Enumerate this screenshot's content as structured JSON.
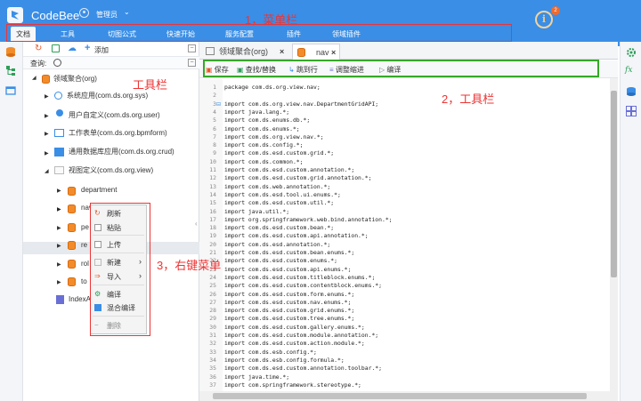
{
  "app": {
    "brand": "CodeBee",
    "user_name": "管理员",
    "notification_count": "2"
  },
  "menu": {
    "items": [
      {
        "label": "文档",
        "active": true
      },
      {
        "label": "工具"
      },
      {
        "label": "切图公式"
      },
      {
        "label": "快速开始"
      },
      {
        "label": "服务配置"
      },
      {
        "label": "插件"
      },
      {
        "label": "领域插件"
      }
    ]
  },
  "annotations": {
    "menu_bar": "1，菜单栏",
    "toolbar": "2，工具栏",
    "left_toolbar": "工具栏",
    "context_menu": "3，右键菜单"
  },
  "left": {
    "add_label": "添加",
    "query_label": "查询:",
    "tree": [
      {
        "label": "领域聚合(org)"
      },
      {
        "label": "系统应用(com.ds.org.sys)"
      },
      {
        "label": "用户自定义(com.ds.org.user)"
      },
      {
        "label": "工作表单(com.ds.org.bpmform)"
      },
      {
        "label": "通用数据库应用(com.ds.org.crud)"
      },
      {
        "label": "视图定义(com.ds.org.view)"
      },
      {
        "label": "department"
      },
      {
        "label": "nav"
      },
      {
        "label": "pe"
      },
      {
        "label": "re"
      },
      {
        "label": "rol"
      },
      {
        "label": "to"
      },
      {
        "label": "IndexA"
      }
    ]
  },
  "context_menu": {
    "items": [
      {
        "label": "刷新"
      },
      {
        "label": "粘贴"
      },
      {
        "label": "上传"
      },
      {
        "label": "新建"
      },
      {
        "label": "导入"
      },
      {
        "label": "编译"
      },
      {
        "label": "混合编译"
      },
      {
        "label": "删除"
      }
    ]
  },
  "editor": {
    "tabs": [
      {
        "label": "领域聚合(org)"
      },
      {
        "label": "nav",
        "active": true
      }
    ],
    "toolbar": [
      {
        "label": "保存"
      },
      {
        "label": "查找/替换"
      },
      {
        "label": "跳到行"
      },
      {
        "label": "调整缩进"
      },
      {
        "label": "编译"
      }
    ],
    "code": [
      "package com.ds.org.view.nav;",
      "",
      "import com.ds.org.view.nav.DepartmentGridAPI;",
      "import java.lang.*;",
      "import com.ds.enums.db.*;",
      "import com.ds.enums.*;",
      "import com.ds.org.view.nav.*;",
      "import com.ds.config.*;",
      "import com.ds.esd.custom.grid.*;",
      "import com.ds.common.*;",
      "import com.ds.esd.custom.annotation.*;",
      "import com.ds.esd.custom.grid.annotation.*;",
      "import com.ds.web.annotation.*;",
      "import com.ds.esd.tool.ui.enums.*;",
      "import com.ds.esd.custom.util.*;",
      "import java.util.*;",
      "import org.springframework.web.bind.annotation.*;",
      "import com.ds.esd.custom.bean.*;",
      "import com.ds.esd.custom.api.annotation.*;",
      "import com.ds.esd.annotation.*;",
      "import com.ds.esd.custom.bean.enums.*;",
      "import com.ds.esd.custom.enums.*;",
      "import com.ds.esd.custom.api.enums.*;",
      "import com.ds.esd.custom.titleblock.enums.*;",
      "import com.ds.esd.custom.contentblock.enums.*;",
      "import com.ds.esd.custom.form.enums.*;",
      "import com.ds.esd.custom.nav.enums.*;",
      "import com.ds.esd.custom.grid.enums.*;",
      "import com.ds.esd.custom.tree.enums.*;",
      "import com.ds.esd.custom.gallery.enums.*;",
      "import com.ds.esd.custom.module.annotation.*;",
      "import com.ds.esd.custom.action.module.*;",
      "import com.ds.esb.config.*;",
      "import com.ds.esb.config.formula.*;",
      "import com.ds.esd.custom.annotation.toolbar.*;",
      "import java.time.*;",
      "import com.springframework.stereotype.*;"
    ]
  }
}
